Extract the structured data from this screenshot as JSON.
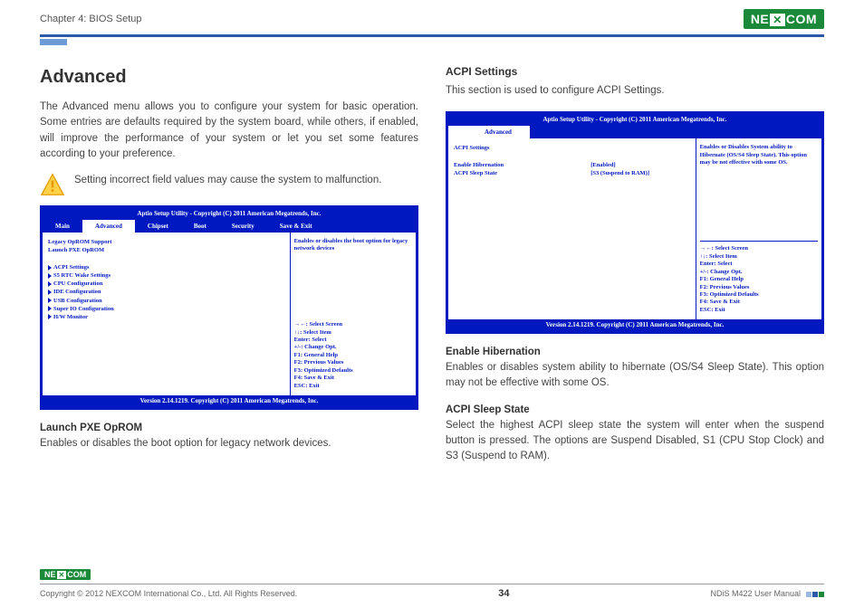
{
  "header": {
    "chapter": "Chapter 4: BIOS Setup",
    "brand_a": "NE",
    "brand_b": "COM"
  },
  "title": "Advanced",
  "intro": "The Advanced menu allows you to configure your system for basic operation. Some entries are defaults required by the system board, while others, if enabled, will improve the performance of your system or let you set some features according to your preference.",
  "warning": "Setting incorrect field values may cause the system to malfunction.",
  "bios1": {
    "title": "Aptio Setup Utility - Copyright (C) 2011 American Megatrends, Inc.",
    "tabs": [
      "Main",
      "Advanced",
      "Chipset",
      "Boot",
      "Security",
      "Save & Exit"
    ],
    "active_tab": "Advanced",
    "left": {
      "l1": "Legacy OpROM Support",
      "l2": "Launch PXE OpROM",
      "items": [
        "ACPI Settings",
        "S5 RTC Wake Settings",
        "CPU Configuration",
        "IDE Configuration",
        "USB Configuration",
        "Super IO Configuration",
        "H/W Monitor"
      ]
    },
    "right_help": "Enables or disables the boot option for legacy network devices",
    "keys": [
      "→←: Select Screen",
      "↑↓: Select Item",
      "Enter: Select",
      "+/-: Change Opt.",
      "F1: General Help",
      "F2: Previous Values",
      "F3: Optimized Defaults",
      "F4: Save & Exit",
      "ESC: Exit"
    ],
    "footer": "Version 2.14.1219. Copyright (C) 2011 American Megatrends, Inc."
  },
  "field1": {
    "name": "Launch PXE OpROM",
    "desc": "Enables or disables the boot option for legacy network devices."
  },
  "acpi": {
    "heading": "ACPI Settings",
    "intro": "This section is used to configure ACPI Settings."
  },
  "bios2": {
    "title": "Aptio Setup Utility - Copyright (C) 2011 American Megatrends, Inc.",
    "active_tab": "Advanced",
    "left": {
      "h": "ACPI Settings",
      "r1": {
        "k": "Enable Hibernation",
        "v": "[Enabled]"
      },
      "r2": {
        "k": "ACPI Sleep State",
        "v": "[S3 (Suspend to RAM)]"
      }
    },
    "right_help": "Enables or Disables System ability to Hibernate (OS/S4 Sleep State). This option may be not effective with some OS.",
    "keys": [
      "→←: Select Screen",
      "↑↓: Select Item",
      "Enter: Select",
      "+/-: Change Opt.",
      "F1: General Help",
      "F2: Previous Values",
      "F3: Optimized Defaults",
      "F4: Save & Exit",
      "ESC: Exit"
    ],
    "footer": "Version 2.14.1219. Copyright (C) 2011 American Megatrends, Inc."
  },
  "field2": {
    "name": "Enable Hibernation",
    "desc": "Enables or disables system ability to hibernate (OS/S4 Sleep State). This option may not be effective with some OS."
  },
  "field3": {
    "name": "ACPI Sleep State",
    "desc": "Select the highest ACPI sleep state the system will enter when the suspend button is pressed. The options are Suspend Disabled, S1 (CPU Stop Clock) and S3 (Suspend to RAM)."
  },
  "footer": {
    "copyright": "Copyright © 2012 NEXCOM International Co., Ltd. All Rights Reserved.",
    "page": "34",
    "manual": "NDiS M422 User Manual"
  }
}
